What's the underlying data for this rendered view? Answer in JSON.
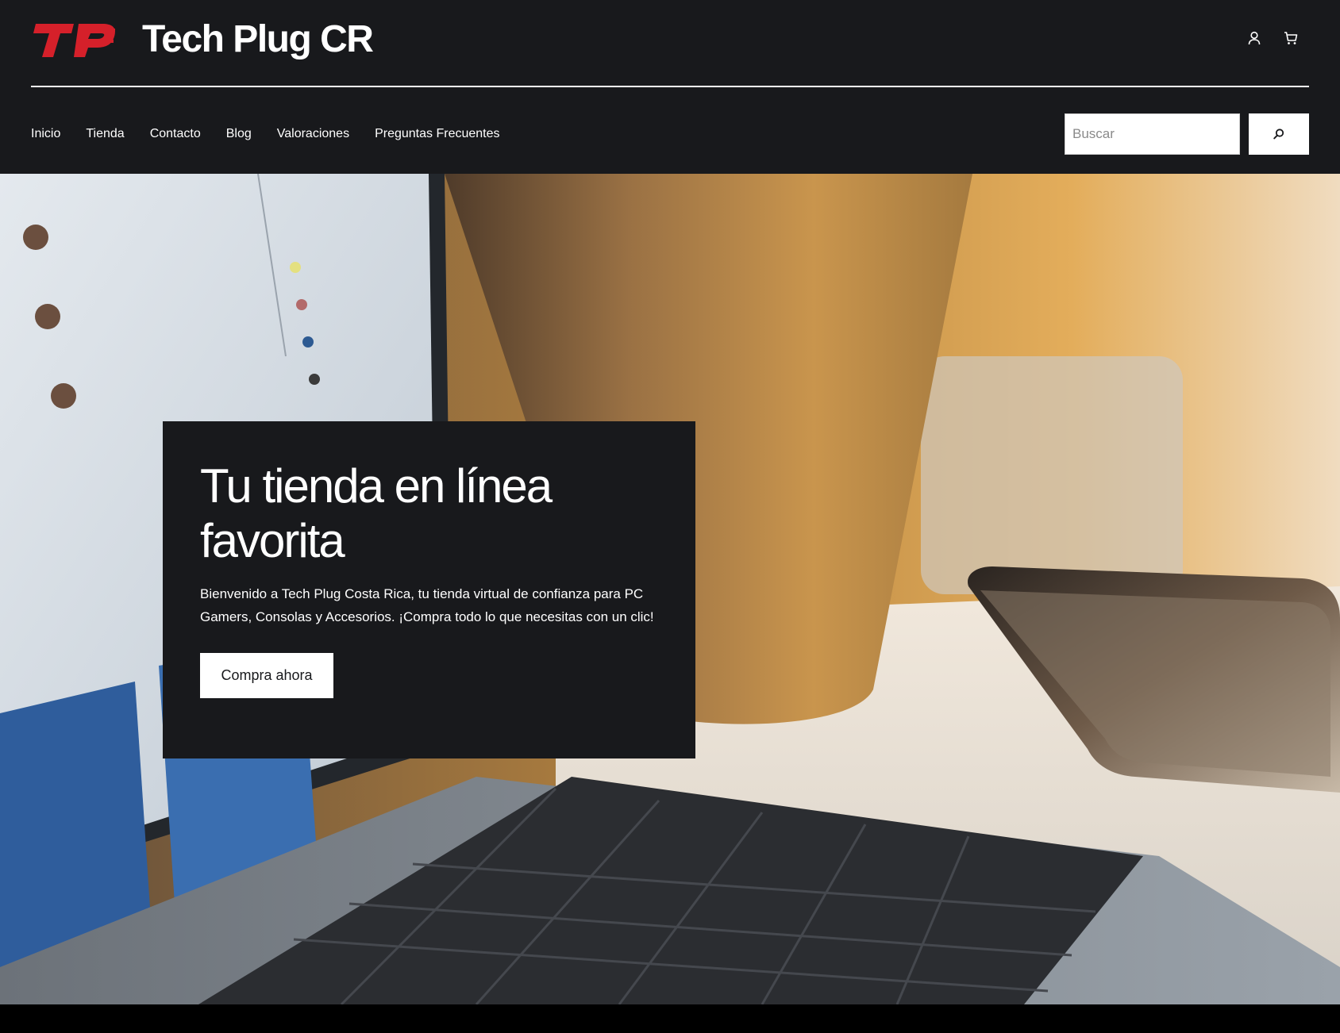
{
  "brand": {
    "logo_text": "TP",
    "site_title": "Tech Plug CR"
  },
  "colors": {
    "header_bg": "#18191c",
    "logo_red": "#d5202a",
    "text_white": "#ffffff"
  },
  "header_icons": [
    {
      "name": "user-icon"
    },
    {
      "name": "cart-icon"
    }
  ],
  "nav": {
    "items": [
      {
        "label": "Inicio"
      },
      {
        "label": "Tienda"
      },
      {
        "label": "Contacto"
      },
      {
        "label": "Blog"
      },
      {
        "label": "Valoraciones"
      },
      {
        "label": "Preguntas Frecuentes"
      }
    ]
  },
  "search": {
    "placeholder": "Buscar",
    "value": "",
    "button_icon": "search-icon"
  },
  "hero": {
    "title": "Tu tienda en línea favorita",
    "text": "Bienvenido a Tech Plug Costa Rica, tu tienda virtual de confianza para PC Gamers, Consolas y Accesorios. ¡Compra todo lo que necesitas con un clic!",
    "cta_label": "Compra ahora",
    "background": "laptop-keyboard-phone-desk-photo"
  }
}
